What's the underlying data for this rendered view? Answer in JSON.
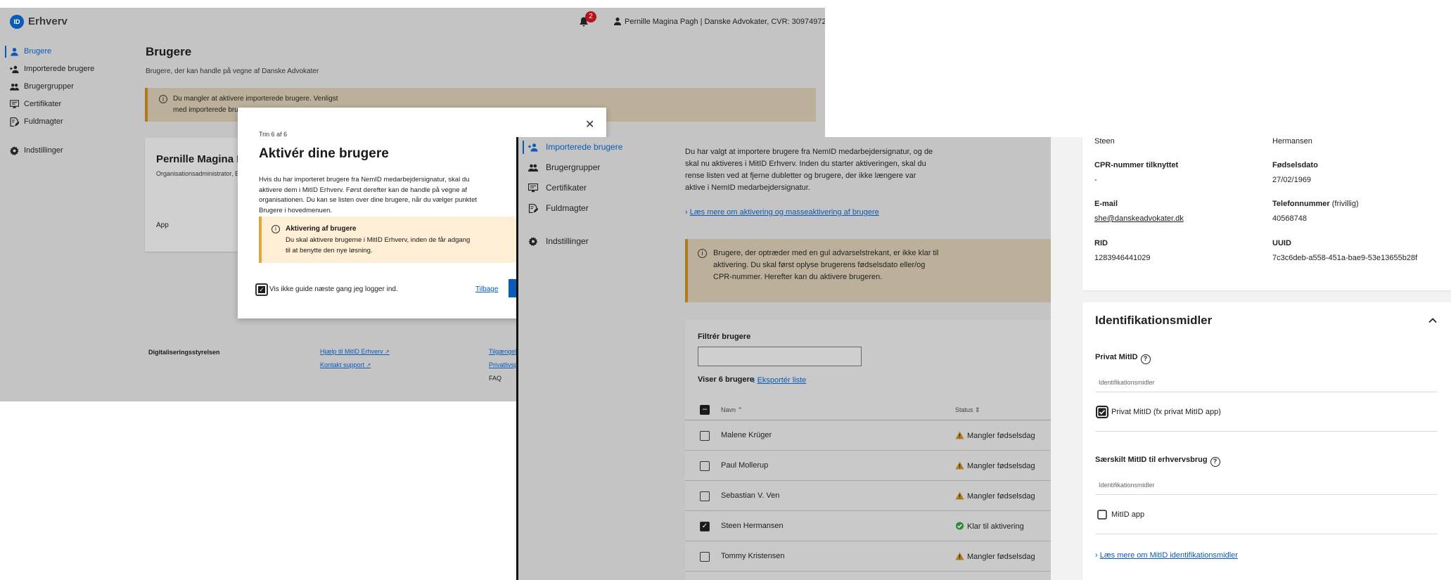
{
  "panel_a": {
    "brand": "Erhverv",
    "logo_text": "ID",
    "notification_count": "2",
    "user_label": "Pernille Magina Pagh | Danske Advokater, CVR: 30974972",
    "sidebar": [
      {
        "label": "Brugere",
        "icon": "user-icon"
      },
      {
        "label": "Importerede brugere",
        "icon": "user-import-icon"
      },
      {
        "label": "Brugergrupper",
        "icon": "users-icon"
      },
      {
        "label": "Certifikater",
        "icon": "certificate-icon"
      },
      {
        "label": "Fuldmagter",
        "icon": "document-sign-icon"
      },
      {
        "label": "Indstillinger",
        "icon": "gear-icon"
      }
    ],
    "page_title": "Brugere",
    "page_subtitle": "Brugere, der kan handle på vegne af Danske Advokater",
    "warning_line1": "Du mangler at aktivere importerede brugere. Venligst",
    "warning_line2": "med importerede bru",
    "card": {
      "title": "Pernille Magina P",
      "desc": "Organisationsadministrator, Brugeradministrator, Rettighedsadministrator",
      "app": "App"
    },
    "footer": {
      "org": "Digitaliseringsstyrelsen",
      "help_link": "Hjælp til MitID Erhverv",
      "support_link": "Kontakt support",
      "col3": [
        "Tilgængelighed",
        "Privatlivspolitik",
        "FAQ"
      ]
    }
  },
  "modal": {
    "step": "Trin 6 af 6",
    "title": "Aktivér dine brugere",
    "body": "Hvis du har importeret brugere fra NemID medarbejdersignatur, skal du aktivere dem i MitID Erhverv. Først derefter kan de handle på vegne af organisationen. Du kan se listen over dine brugere, når du vælger punktet Brugere i hovedmenuen.",
    "warning_title": "Aktivering af brugere",
    "warning_body": "Du skal aktivere brugerne i MitID Erhverv, inden de får adgang til at benytte den nye løsning.",
    "checkbox_label": "Vis ikke guide næste gang jeg logger ind.",
    "checkbox_checked": true,
    "back_label": "Tilbage",
    "close_icon": "close-icon"
  },
  "panel_b": {
    "sidebar": [
      {
        "label": "Importerede brugere",
        "icon": "user-import-icon"
      },
      {
        "label": "Brugergrupper",
        "icon": "users-icon"
      },
      {
        "label": "Certifikater",
        "icon": "certificate-icon"
      },
      {
        "label": "Fuldmagter",
        "icon": "document-sign-icon"
      },
      {
        "label": "Indstillinger",
        "icon": "gear-icon"
      }
    ],
    "intro": "Du har valgt at importere brugere fra NemID medarbejdersignatur, og de skal nu aktiveres i MitID Erhverv. Inden du starter aktiveringen, skal du rense listen ved at fjerne dubletter og brugere, der ikke længere var aktive i NemID medarbejdersignatur.",
    "more_link": "Læs mere om aktivering og masseaktivering af brugere",
    "warning": "Brugere, der optræder med en gul advarselstrekant, er ikke klar til aktivering. Du skal først oplyse brugerens fødselsdato eller/og CPR-nummer. Herefter kan du aktivere brugeren.",
    "filter_label": "Filtrér brugere",
    "filter_value": "",
    "count_label": "Viser 6 brugere",
    "export_label": "Eksportér liste",
    "col_name": "Navn",
    "col_status": "Status",
    "rows": [
      {
        "name": "Malene Krüger",
        "status": "Mangler fødselsdag",
        "state": "warn",
        "checked": false
      },
      {
        "name": "Paul Mollerup",
        "status": "Mangler fødselsdag",
        "state": "warn",
        "checked": false
      },
      {
        "name": "Sebastian V. Ven",
        "status": "Mangler fødselsdag",
        "state": "warn",
        "checked": false
      },
      {
        "name": "Steen Hermansen",
        "status": "Klar til aktivering",
        "state": "ok",
        "checked": true
      },
      {
        "name": "Tommy Kristensen",
        "status": "Mangler fødselsdag",
        "state": "warn",
        "checked": false
      }
    ]
  },
  "panel_c": {
    "first_name": "Steen",
    "last_name": "Hermansen",
    "cpr_label": "CPR-nummer tilknyttet",
    "cpr_value": "-",
    "dob_label": "Fødselsdato",
    "dob_value": "27/02/1969",
    "email_label": "E-mail",
    "email_value": "she@danskeadvokater.dk",
    "phone_label": "Telefonnummer",
    "phone_optional": "(frivillig)",
    "phone_value": "40568748",
    "rid_label": "RID",
    "rid_value": "1283946441029",
    "uuid_label": "UUID",
    "uuid_value": "7c3c6deb-a558-451a-bae9-53e13655b28f",
    "section_title": "Identifikationsmidler",
    "private_title": "Privat MitID",
    "private_placeholder": "Identifikationsmidler",
    "private_option": "Privat MitID (fx privat MitID app)",
    "private_checked": true,
    "business_title": "Særskilt MitID til erhvervsbrug",
    "business_placeholder": "Identifikationsmidler",
    "business_option": "MitID app",
    "business_checked": false,
    "more_link": "Læs mere om MitID identifikationsmidler"
  },
  "colors": {
    "accent": "#0a5ab8",
    "warning": "#b27a1a",
    "ok": "#2e8b3a",
    "badge": "#b5121b"
  }
}
